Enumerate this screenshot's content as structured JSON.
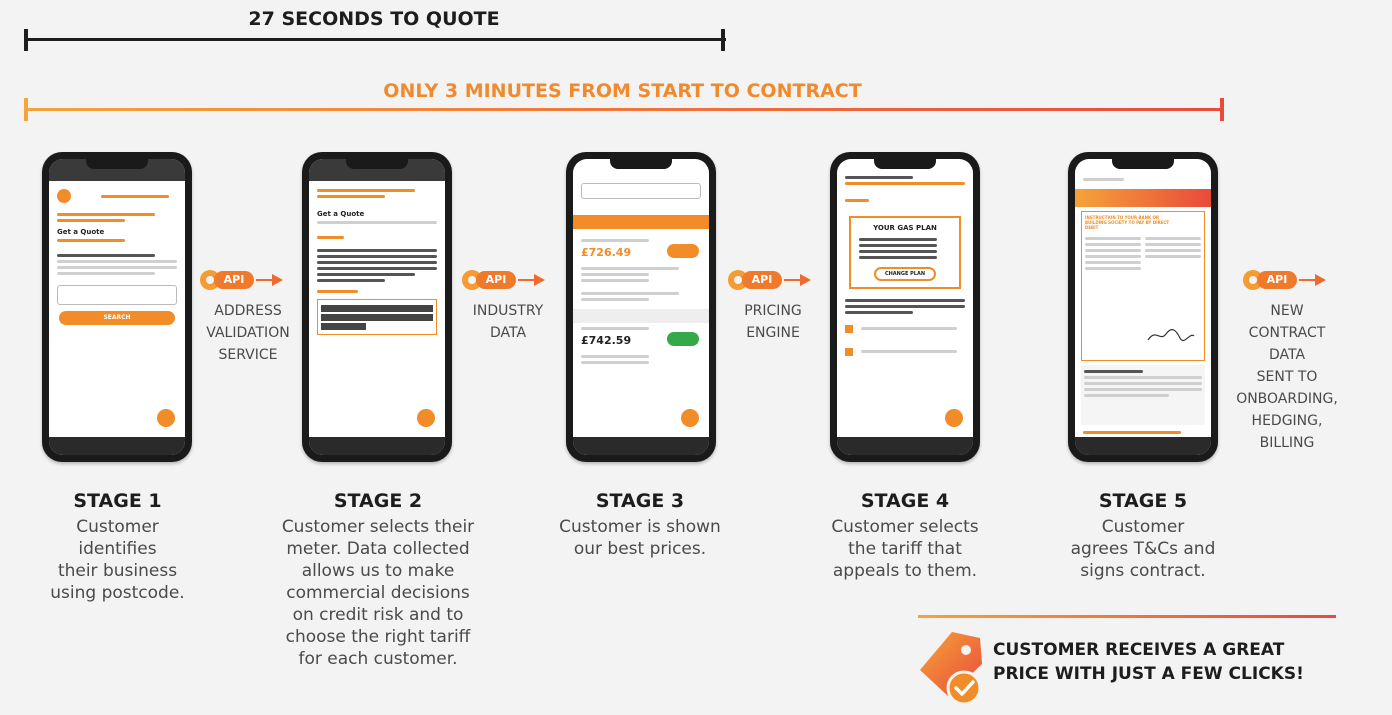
{
  "timelines": {
    "quote": {
      "label": "27 SECONDS TO QUOTE",
      "color": "#1d1d1d"
    },
    "contract": {
      "label": "ONLY 3 MINUTES FROM START TO CONTRACT",
      "color_start": "#f6a33a",
      "color_end": "#e94a3b"
    }
  },
  "api_label": "API",
  "connectors": [
    {
      "label": "ADDRESS\nVALIDATION\nSERVICE"
    },
    {
      "label": "INDUSTRY\nDATA"
    },
    {
      "label": "PRICING\nENGINE"
    },
    {
      "label": "NEW\nCONTRACT\nDATA\nSENT TO\nONBOARDING,\nHEDGING,\nBILLING"
    }
  ],
  "stages": [
    {
      "title": "STAGE 1",
      "desc": "Customer\nidentifies\ntheir business\nusing postcode."
    },
    {
      "title": "STAGE 2",
      "desc": "Customer selects their\nmeter. Data collected\nallows us to make\ncommercial decisions\non credit risk and to\nchoose the right tariff\nfor each customer."
    },
    {
      "title": "STAGE 3",
      "desc": "Customer is shown\nour best prices."
    },
    {
      "title": "STAGE 4",
      "desc": "Customer selects\nthe tariff that\nappeals to them."
    },
    {
      "title": "STAGE 5",
      "desc": "Customer\nagrees T&Cs and\nsigns contract."
    }
  ],
  "phones": [
    {
      "screen_title": "Get a Quote",
      "button": "SEARCH"
    },
    {
      "screen_title": "Get a Quote"
    },
    {
      "price_1": "£726.49",
      "price_2": "£742.59"
    },
    {
      "screen_title": "YOUR GAS PLAN",
      "button": "CHANGE PLAN"
    },
    {
      "screen_title": "INSTRUCTION TO YOUR BANK OR BUILDING SOCIETY TO PAY BY DIRECT DEBIT"
    }
  ],
  "final": {
    "text": "CUSTOMER RECEIVES A GREAT\nPRICE WITH JUST A FEW CLICKS!"
  },
  "colors": {
    "accent": "#f28c28",
    "arrow": "#ef6a2c",
    "background": "#f3f3f3"
  }
}
